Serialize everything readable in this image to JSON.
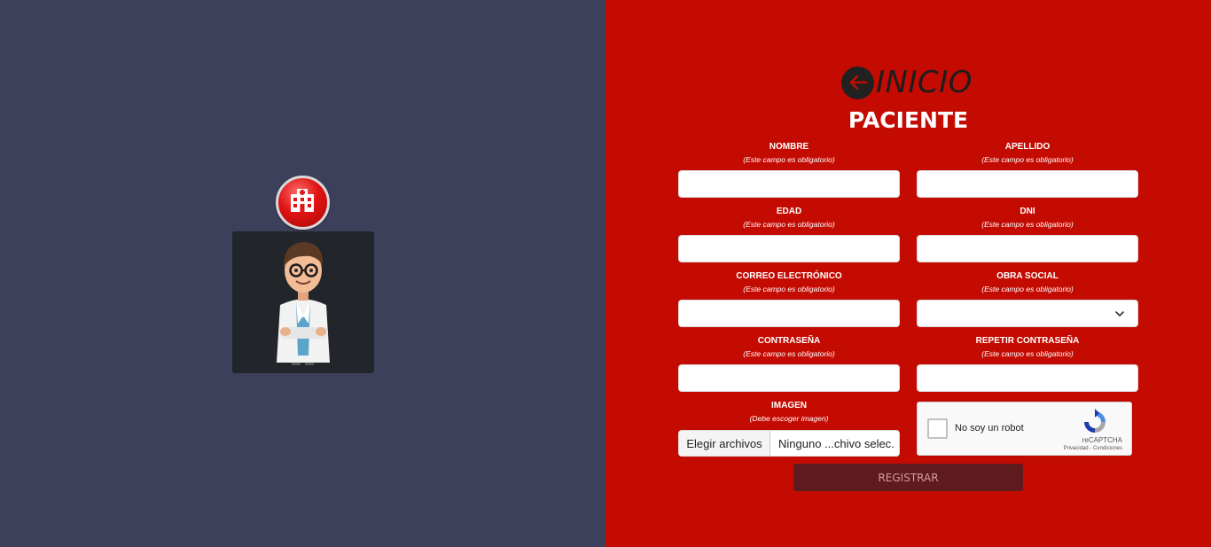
{
  "nav": {
    "back_label": "INICIO"
  },
  "form": {
    "title": "PACIENTE",
    "required_note": "(Este campo es obligatorio)",
    "fields": {
      "nombre": {
        "label": "NOMBRE",
        "value": ""
      },
      "apellido": {
        "label": "APELLIDO",
        "value": ""
      },
      "edad": {
        "label": "EDAD",
        "value": ""
      },
      "dni": {
        "label": "DNI",
        "value": ""
      },
      "correo": {
        "label": "CORREO ELECTRÓNICO",
        "value": ""
      },
      "obra_social": {
        "label": "OBRA SOCIAL",
        "selected": ""
      },
      "contrasena": {
        "label": "CONTRASEÑA",
        "value": ""
      },
      "repetir_contrasena": {
        "label": "REPETIR CONTRASEÑA",
        "value": ""
      }
    },
    "image": {
      "label": "IMAGEN",
      "note": "(Debe escoger imagen)",
      "button_label": "Elegir archivos",
      "file_status": "Ninguno ...chivo selec."
    },
    "captcha": {
      "label": "No soy un robot",
      "brand": "reCAPTCHA",
      "terms": "Privacidad - Condiciones"
    },
    "submit_label": "REGISTRAR"
  },
  "icons": {
    "back": "arrow-left-icon",
    "hospital": "hospital-icon",
    "avatar": "doctor-avatar",
    "select": "chevron-down-icon",
    "captcha": "recaptcha-logo"
  },
  "colors": {
    "left_panel": "#3d405b",
    "right_panel": "#c40b02",
    "submit_bg": "#5e1b1e"
  }
}
